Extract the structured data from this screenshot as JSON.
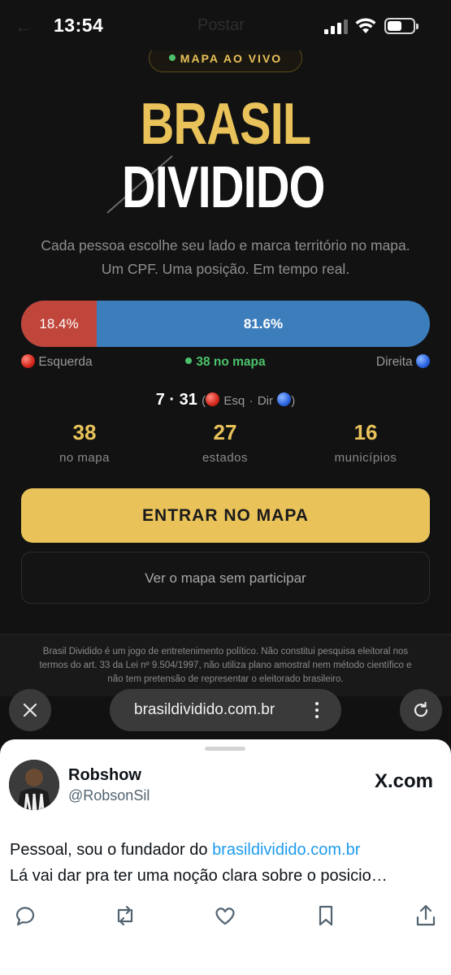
{
  "status_bar": {
    "time": "13:54",
    "ghost_back": "←",
    "ghost_title": "Postar"
  },
  "site": {
    "live_badge": "MAPA AO VIVO",
    "logo_top": "BRASIL",
    "logo_bottom": "DIVIDIDO",
    "subtitle_line1": "Cada pessoa escolhe seu lado e marca território no mapa.",
    "subtitle_line2": "Um CPF. Uma posição. Em tempo real.",
    "bar": {
      "left_label": "18.4%",
      "right_label": "81.6%",
      "left_fraction": 0.184,
      "left_color": "#c0453a",
      "right_color": "#3c7dbc"
    },
    "legend": {
      "left": "Esquerda",
      "middle": "38 no mapa",
      "right": "Direita"
    },
    "ratio": {
      "numbers": "7 · 31",
      "open": "(",
      "esq": "Esq",
      "sep": "·",
      "dir": "Dir",
      "close": ")"
    },
    "stats": [
      {
        "num": "38",
        "cap": "no mapa"
      },
      {
        "num": "27",
        "cap": "estados"
      },
      {
        "num": "16",
        "cap": "municípios"
      }
    ],
    "cta": "ENTRAR NO MAPA",
    "secondary": "Ver o mapa sem participar",
    "disclaimer_1": "Brasil Dividido é um jogo de entretenimento político. Não constitui pesquisa eleitoral nos",
    "disclaimer_2": "termos do art. 33 da Lei nº 9.504/1997, não utiliza plano amostral nem método científico e",
    "disclaimer_3": "não tem pretensão de representar o eleitorado brasileiro.",
    "accent": "#e9c25a"
  },
  "browser": {
    "url": "brasildividido.com.br"
  },
  "share_card": {
    "name": "Robshow",
    "handle": "@RobsonSil",
    "source": "X.com",
    "tweet_prefix": "Pessoal, sou o fundador do ",
    "tweet_link": "brasildividido.com.br",
    "tweet_line2": "Lá vai dar pra ter uma noção clara sobre o posicio…"
  }
}
